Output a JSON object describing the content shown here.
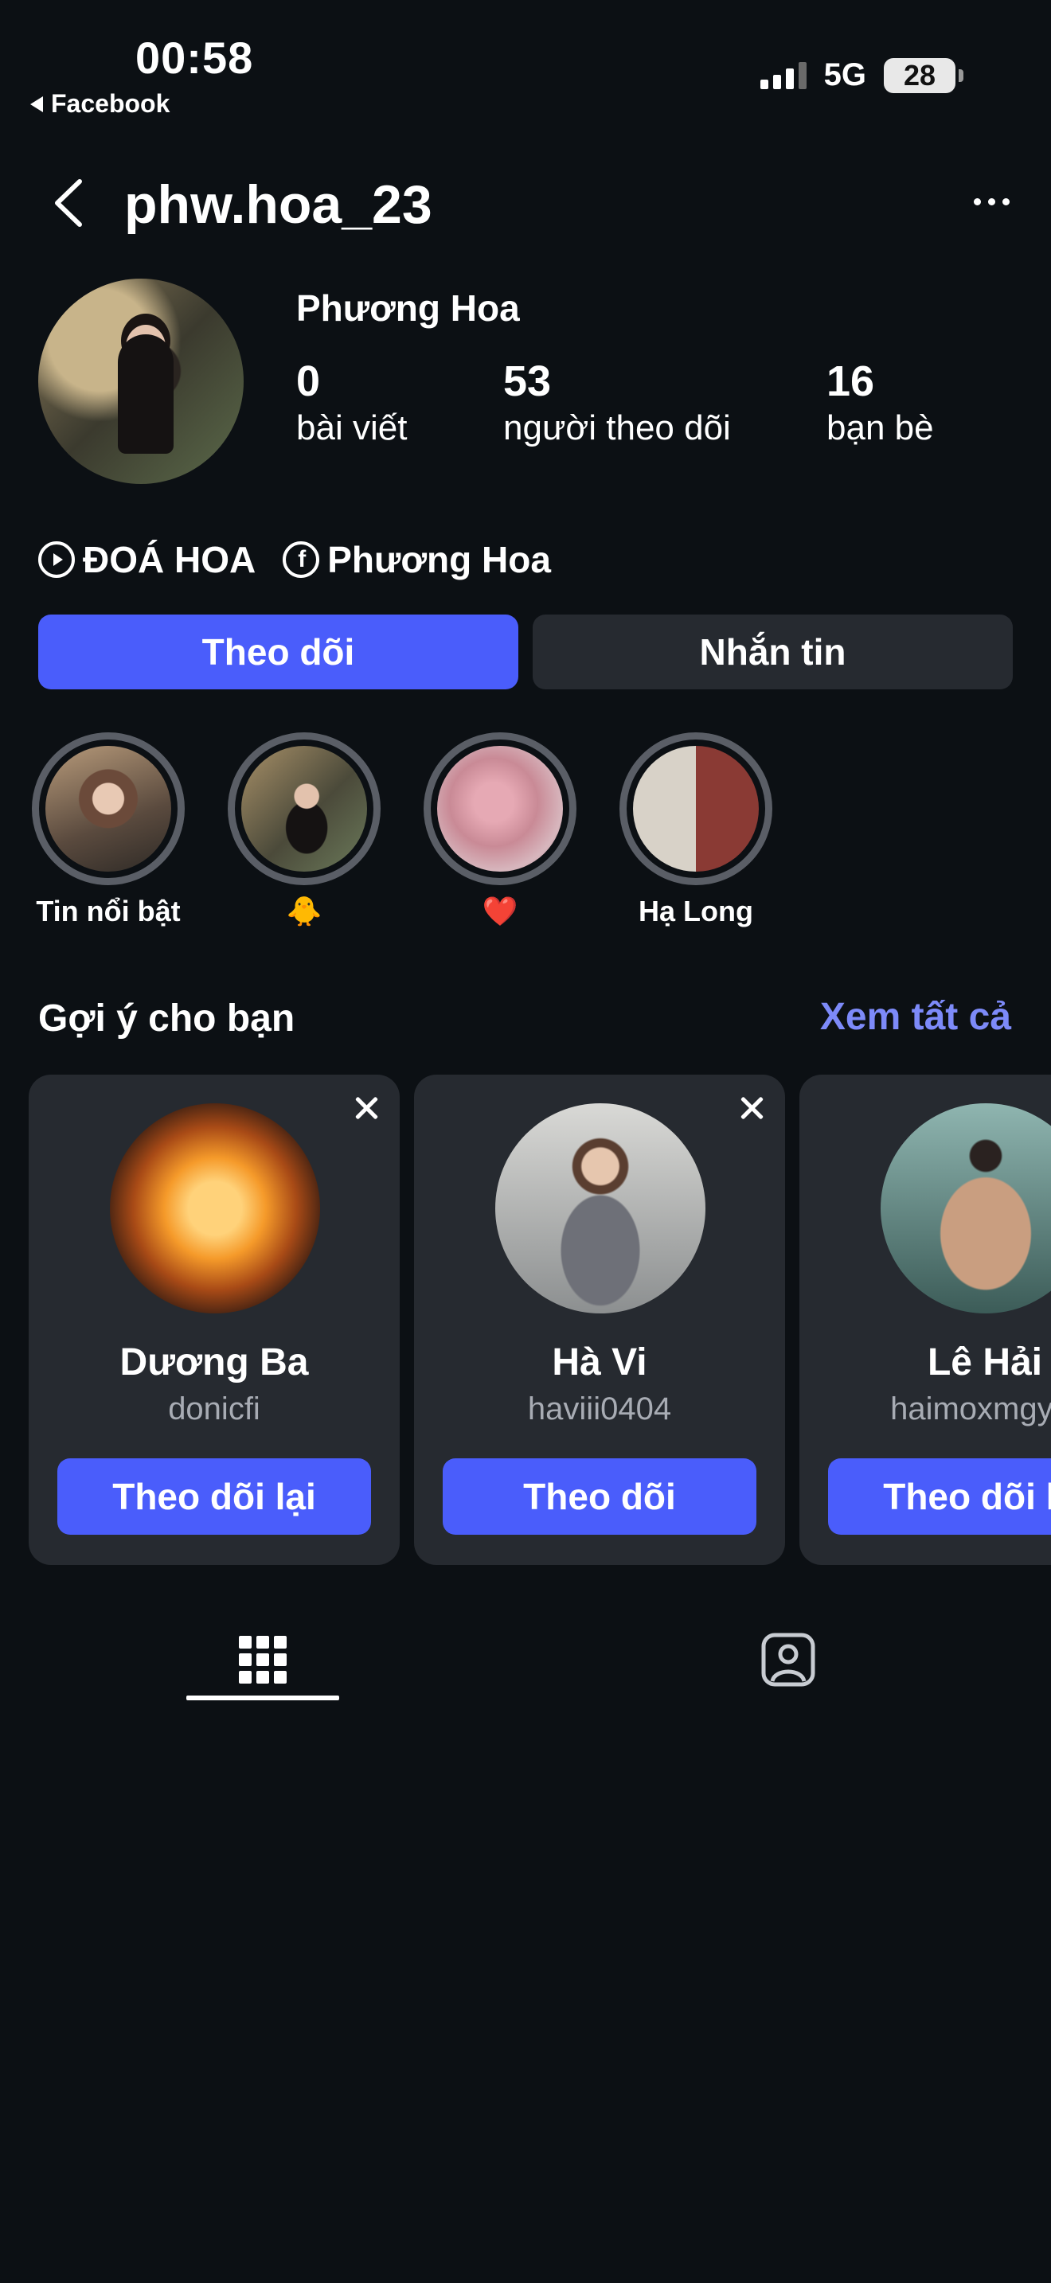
{
  "status_bar": {
    "time": "00:58",
    "back_app": "Facebook",
    "network": "5G",
    "battery": "28"
  },
  "header": {
    "username": "phw.hoa_23",
    "back_icon": "chevron-left-icon",
    "more_icon": "more-horizontal-icon"
  },
  "profile": {
    "display_name": "Phương Hoa",
    "stats": [
      {
        "value": "0",
        "label": "bài viết"
      },
      {
        "value": "53",
        "label": "người theo dõi"
      },
      {
        "value": "16",
        "label": "bạn bè"
      }
    ],
    "links": [
      {
        "icon": "play-circle-icon",
        "label": "ĐOÁ HOA"
      },
      {
        "icon": "facebook-icon",
        "label": "Phương Hoa"
      }
    ],
    "follow_label": "Theo dõi",
    "message_label": "Nhắn tin"
  },
  "highlights": [
    {
      "label": "Tin nổi bật"
    },
    {
      "label": "🐥"
    },
    {
      "label": "❤️"
    },
    {
      "label": "Hạ Long"
    }
  ],
  "suggestions": {
    "title": "Gợi ý cho bạn",
    "see_all": "Xem tất cả",
    "cards": [
      {
        "name": "Dương Ba",
        "handle": "donicfi",
        "button": "Theo dõi lại"
      },
      {
        "name": "Hà Vi",
        "handle": "haviii0404",
        "button": "Theo dõi"
      },
      {
        "name": "Lê Hải",
        "handle": "haimoxmgym",
        "button": "Theo dõi lại"
      }
    ]
  },
  "tabs": [
    {
      "icon": "grid-icon",
      "active": true
    },
    {
      "icon": "tagged-person-icon",
      "active": false
    }
  ],
  "colors": {
    "background": "#0c1014",
    "primary_button": "#4a5dfb",
    "secondary_button": "#262a30",
    "link_accent": "#7d8af9"
  }
}
